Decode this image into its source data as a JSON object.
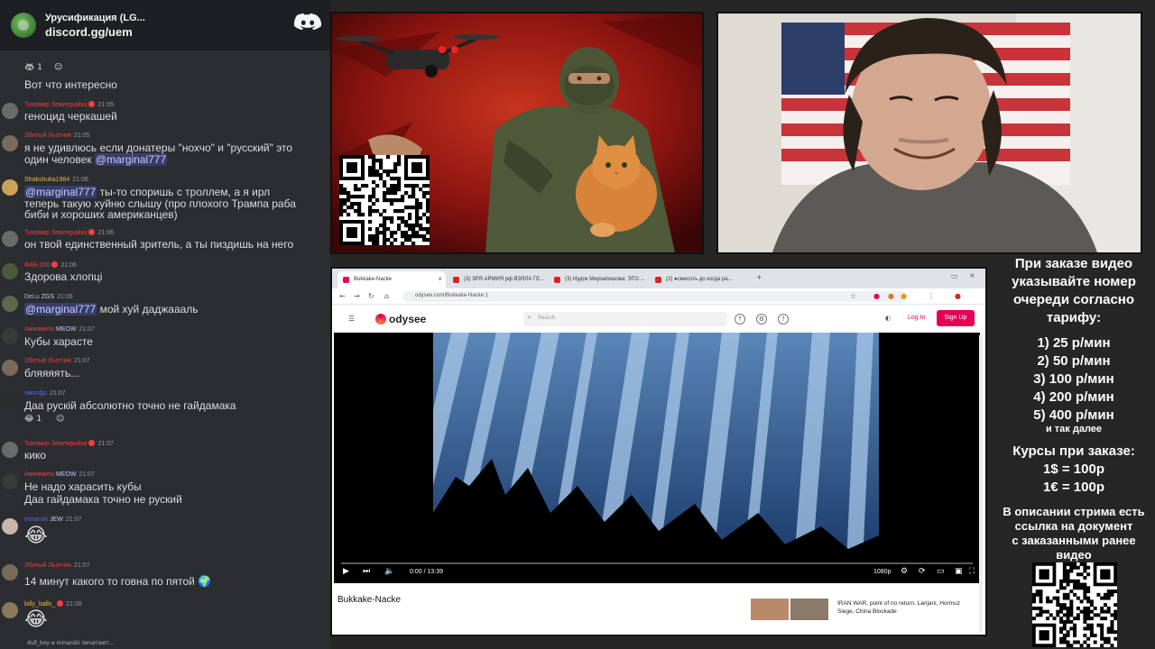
{
  "discord": {
    "server_name": "Урусификация (LG...",
    "invite": "discord.gg/uem",
    "typing": "dull_boy и minarski печатают..."
  },
  "messages": [
    {
      "name": "",
      "name_color": "#dbdee1",
      "time": "",
      "text": "Вот что интересно",
      "react": "🦝 1"
    },
    {
      "name": "Тихомир Землеройка",
      "name_color": "#f23f43",
      "time": "21:05",
      "text": "геноцид черкашей"
    },
    {
      "name": "Збитый Льотчик",
      "name_color": "#f23f43",
      "time": "21:05",
      "text": "я не удивлюсь если донатеры \"нохчо\" и \"русский\" это",
      "text2": "один человек",
      "mention": "@marginal777"
    },
    {
      "name": "Shakshuka1984",
      "name_color": "#e8b84a",
      "time": "21:06",
      "mention": "@marginal777",
      "text": "ты-то споришь с троллем, а я ирл",
      "text2": "теперь такую хуйню слышу (про плохого Трампа раба",
      "text3": "биби и хороших американцев)"
    },
    {
      "name": "Тихомир Землеройка",
      "name_color": "#f23f43",
      "time": "21:06",
      "text": "он твой единственный зритель, а ты пиздишь на него"
    },
    {
      "name": "ФАБ-200",
      "name_color": "#f23f43",
      "time": "21:06",
      "text": "Здорова хлопці"
    },
    {
      "name": "DeLu",
      "name_color": "#b5bac1",
      "tag": "ZGS",
      "time": "21:06",
      "mention": "@marginal777",
      "text": "мой хуй даджаааль"
    },
    {
      "name": "Амнямити",
      "name_color": "#f23f43",
      "tag": "MEOW",
      "time": "21:07",
      "text": "Кубы харасте"
    },
    {
      "name": "Збитый Льотчик",
      "name_color": "#f23f43",
      "time": "21:07",
      "text": "бляяяять..."
    },
    {
      "name": "чмотфр",
      "name_color": "#5865f2",
      "time": "21:07",
      "text": "Даа рускій абсолютно точно не гайдамака",
      "react": "😂 1"
    },
    {
      "name": "Тихомир Землеройка",
      "name_color": "#f23f43",
      "time": "21:07",
      "text": "кико"
    },
    {
      "name": "Амнямити",
      "name_color": "#f23f43",
      "tag": "MEOW",
      "time": "21:07",
      "text": "Не надо харасить кубы",
      "text2": "Даа гайдамака точно не руский"
    },
    {
      "name": "minarski",
      "name_color": "#5865f2",
      "tag": "JEW",
      "time": "21:07",
      "emoji": "😂"
    },
    {
      "name": "Збитый Льотчик",
      "name_color": "#f23f43",
      "time": "21:07",
      "text": "14 минут какого то говна по пятой 🌍"
    },
    {
      "name": "billy_balls_",
      "name_color": "#e8b84a",
      "time": "21:08",
      "emoji": "😂"
    }
  ],
  "browser": {
    "tabs": [
      "Bukkake-Nacke",
      "(3) ЗРЯ АРМИЯ рф ВЗЯЛА ГЕ...",
      "(3) Иудок Мирзапишова: ЭТО ...",
      "(2) ●смесоть до когда ра..."
    ],
    "url": "odysee.com/Bukkake-Nacke:1",
    "logo": "odysee",
    "search_placeholder": "Search",
    "login": "Log In",
    "signup": "Sign Up",
    "time": "0:00 / 13:39",
    "quality": "1080p",
    "progress": 0,
    "video_title": "Bukkake-Nacke",
    "related_title": "IRAN WAR, point of no return. Larijani, Hormuz Siege, China Blockade"
  },
  "info": {
    "l1": "При заказе видео",
    "l2": "указывайте номер",
    "l3": "очереди согласно",
    "l4": "тарифу:",
    "p1": "1) 25 р/мин",
    "p2": "2) 50 р/мин",
    "p3": "3) 100 р/мин",
    "p4": "4) 200 р/мин",
    "p5": "5) 400 р/мин",
    "p6": "и так далее",
    "c1": "Курсы при заказе:",
    "c2": "1$ = 100р",
    "c3": "1€ = 100р",
    "d1": "В описании стрима есть",
    "d2": "ссылка на документ",
    "d3": "с заказанными ранее",
    "d4": "видео"
  }
}
